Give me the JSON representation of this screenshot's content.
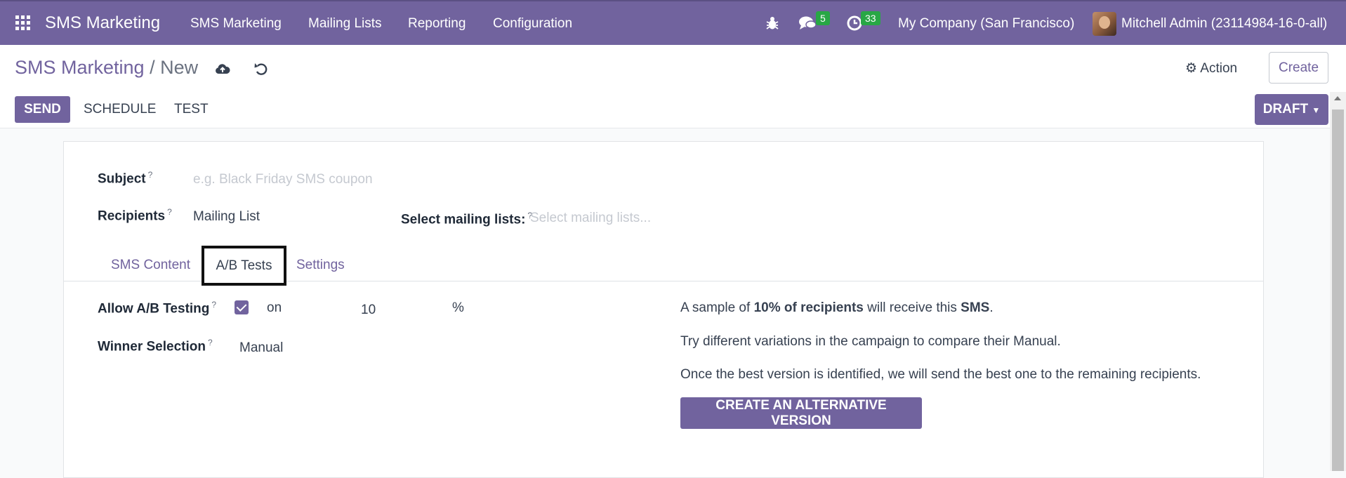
{
  "nav": {
    "app_name": "SMS Marketing",
    "menu": [
      "SMS Marketing",
      "Mailing Lists",
      "Reporting",
      "Configuration"
    ],
    "messages_count": "5",
    "activities_count": "33",
    "company": "My Company (San Francisco)",
    "user": "Mitchell Admin (23114984-16-0-all)"
  },
  "control": {
    "breadcrumb_root": "SMS Marketing",
    "breadcrumb_sep": "/",
    "breadcrumb_current": "New",
    "action_label": "Action",
    "create_label": "Create",
    "send_label": "SEND",
    "schedule_label": "SCHEDULE",
    "test_label": "TEST",
    "status_label": "DRAFT"
  },
  "form": {
    "subject_label": "Subject",
    "subject_placeholder": "e.g. Black Friday SMS coupon",
    "recipients_label": "Recipients",
    "recipients_value": "Mailing List",
    "mailing_lists_label": "Select mailing lists:",
    "mailing_lists_placeholder": "Select mailing lists...",
    "help_mark": "?",
    "tabs": [
      "SMS Content",
      "A/B Tests",
      "Settings"
    ],
    "ab_label": "Allow A/B Testing",
    "ab_on": "on",
    "ab_percent": "10",
    "percent_sign": "%",
    "winner_label": "Winner Selection",
    "winner_value": "Manual",
    "info": {
      "line1_a": "A sample of ",
      "line1_b": "10% of recipients",
      "line1_c": " will receive this ",
      "line1_d": "SMS",
      "line1_e": ".",
      "line2": "Try different variations in the campaign to compare their Manual.",
      "line3": "Once the best version is identified, we will send the best one to the remaining recipients."
    },
    "alt_button": "CREATE AN ALTERNATIVE VERSION"
  },
  "colors": {
    "brand": "#71639e",
    "badge": "#28a745"
  },
  "icons": [
    "apps-grid-icon",
    "bug-icon",
    "chat-icon",
    "clock-icon",
    "cloud-upload-icon",
    "undo-icon",
    "gear-icon",
    "caret-down-icon"
  ]
}
